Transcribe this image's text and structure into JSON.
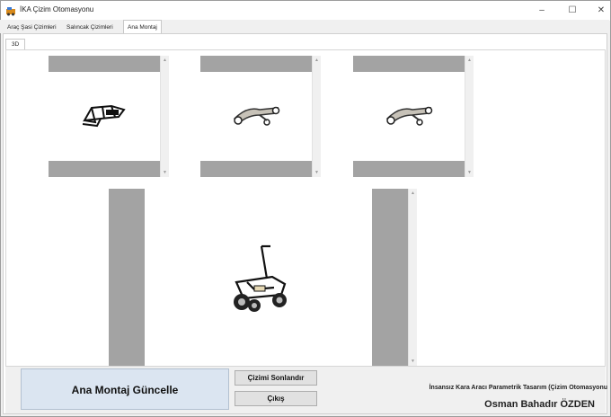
{
  "window": {
    "title": "İKA Çizim Otomasyonu",
    "controls": {
      "minimize": "–",
      "maximize": "☐",
      "close": "✕"
    }
  },
  "tabs": [
    {
      "label": "Araç Şasi Çizimleri"
    },
    {
      "label": "Salıncak Çizimleri"
    },
    {
      "label": "Ana Montaj",
      "active": true
    }
  ],
  "subtabs": [
    {
      "label": "3D"
    }
  ],
  "viewers": [
    {
      "name": "chassis-preview",
      "icon": "chassis-part"
    },
    {
      "name": "upper-arm-preview",
      "icon": "control-arm-part"
    },
    {
      "name": "lower-arm-preview",
      "icon": "control-arm-part"
    },
    {
      "name": "main-assembly-preview",
      "icon": "vehicle-assembly"
    }
  ],
  "buttons": {
    "update_assembly": "Ana Montaj Güncelle",
    "finish_drawing": "Çizimi Sonlandır",
    "exit": "Çıkış"
  },
  "footer": {
    "caption": "İnsansız Kara Aracı Parametrik Tasarım (Çizim Otomasyonu",
    "author": "Osman Bahadır ÖZDEN"
  }
}
